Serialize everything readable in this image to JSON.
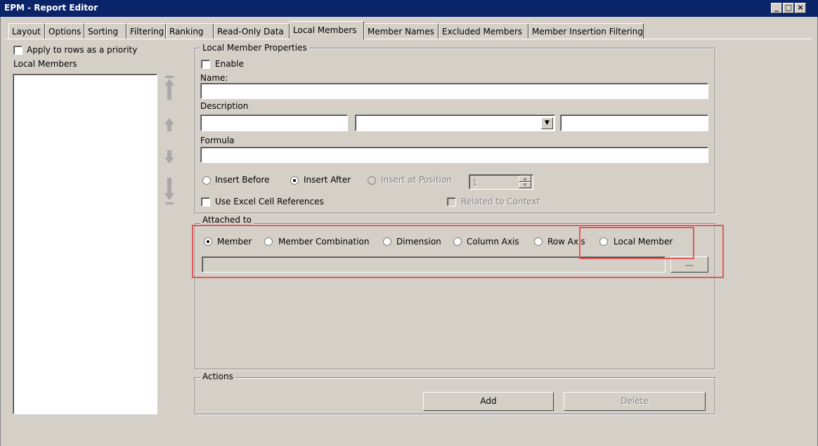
{
  "window": {
    "title": "EPM - Report Editor"
  },
  "titlebar_buttons": [
    "_",
    "□",
    "×"
  ],
  "tabs": [
    {
      "label": "Layout"
    },
    {
      "label": "Options"
    },
    {
      "label": "Sorting"
    },
    {
      "label": "Filtering"
    },
    {
      "label": "Ranking"
    },
    {
      "label": "Read-Only Data"
    },
    {
      "label": "Local Members"
    },
    {
      "label": "Member Names"
    },
    {
      "label": "Excluded Members"
    },
    {
      "label": "Member Insertion Filtering"
    }
  ],
  "active_tab": "Local Members",
  "left": {
    "apply_priority_label": "Apply to rows as a priority",
    "local_members_label": "Local Members"
  },
  "props": {
    "legend": "Local Member Properties",
    "enable_label": "Enable",
    "name_label": "Name:",
    "name_value": "",
    "description_label": "Description",
    "formula_label": "Formula",
    "insert_before": "Insert Before",
    "insert_after": "Insert After",
    "insert_at_position": "Insert at Position",
    "position_value": "1",
    "use_excel_refs": "Use Excel Cell References",
    "related_to_context": "Related to Context"
  },
  "attached": {
    "legend": "Attached to",
    "member": "Member",
    "member_combination": "Member Combination",
    "dimension": "Dimension",
    "column_axis": "Column Axis",
    "row_axis": "Row Axis",
    "local_member": "Local Member",
    "browse_label": "..."
  },
  "actions": {
    "legend": "Actions",
    "add_label": "Add",
    "delete_label": "Delete"
  },
  "colors": {
    "titlebar": "#0a246a",
    "highlight": "#e05a5a",
    "face": "#d4d0c8"
  }
}
